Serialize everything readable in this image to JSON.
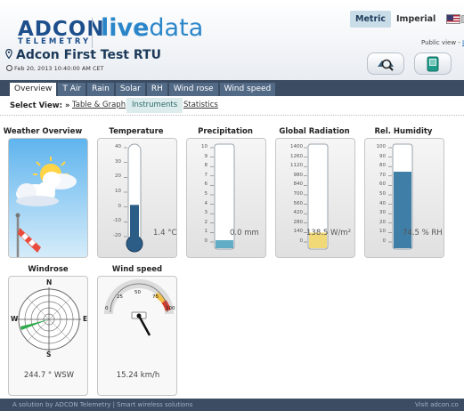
{
  "brand": {
    "logo_main": "ADCON",
    "logo_sub": "TELEMETRY",
    "product_bold": "live",
    "product_rest": "data"
  },
  "header": {
    "unit_metric": "Metric",
    "unit_imperial": "Imperial",
    "public_view_prefix": "Public view - ",
    "public_view_link": "Lo",
    "station_name": "Adcon First Test RTU",
    "station_datetime": "Feb 20, 2013 10:40:00 AM CET",
    "help_glyph": "?"
  },
  "tabs": [
    {
      "label": "Overview",
      "active": true
    },
    {
      "label": "T Air"
    },
    {
      "label": "Rain"
    },
    {
      "label": "Solar"
    },
    {
      "label": "RH"
    },
    {
      "label": "Wind rose"
    },
    {
      "label": "Wind speed"
    }
  ],
  "select_view": {
    "label": "Select View: »",
    "options": [
      "Table & Graph",
      "Instruments",
      "Statistics"
    ],
    "active": "Instruments"
  },
  "widgets": {
    "weather": {
      "title": "Weather Overview"
    },
    "temperature": {
      "title": "Temperature",
      "value": "1.4 °C",
      "scale": [
        "40",
        "30",
        "20",
        "10",
        "0",
        "-10",
        "-20"
      ],
      "level": 1.4
    },
    "precipitation": {
      "title": "Precipitation",
      "value": "0.0 mm",
      "scale": [
        "10",
        "9",
        "8",
        "7",
        "6",
        "5",
        "4",
        "3",
        "2",
        "1",
        "0"
      ],
      "level": 0.0
    },
    "global_radiation": {
      "title": "Global Radiation",
      "value": "138.5 W/m²",
      "scale": [
        "1400",
        "1260",
        "1120",
        "980",
        "840",
        "700",
        "560",
        "420",
        "280",
        "140",
        "0"
      ],
      "level": 138.5
    },
    "rel_humidity": {
      "title": "Rel. Humidity",
      "value": "74.5 % RH",
      "scale": [
        "100",
        "90",
        "80",
        "70",
        "60",
        "50",
        "40",
        "30",
        "20",
        "10",
        "0"
      ],
      "level": 74.5
    },
    "windrose": {
      "title": "Windrose",
      "value": "244.7 ° WSW",
      "compass": {
        "n": "N",
        "e": "E",
        "s": "S",
        "w": "W"
      },
      "direction_deg": 244.7
    },
    "wind_speed": {
      "title": "Wind speed",
      "value": "15.24 km/h",
      "scale": [
        "0",
        "25",
        "50",
        "75",
        "100"
      ]
    }
  },
  "footer": {
    "text": "A solution by ADCON Telemetry | Smart wireless solutions",
    "link": "Visit adcon.co"
  },
  "colors": {
    "brand_blue": "#1d4f8c",
    "live_blue": "#2a86c9",
    "nav_bar": "#3c4d63",
    "tab_bg": "#536a86",
    "gauge_fill": "#3f7ea6"
  }
}
